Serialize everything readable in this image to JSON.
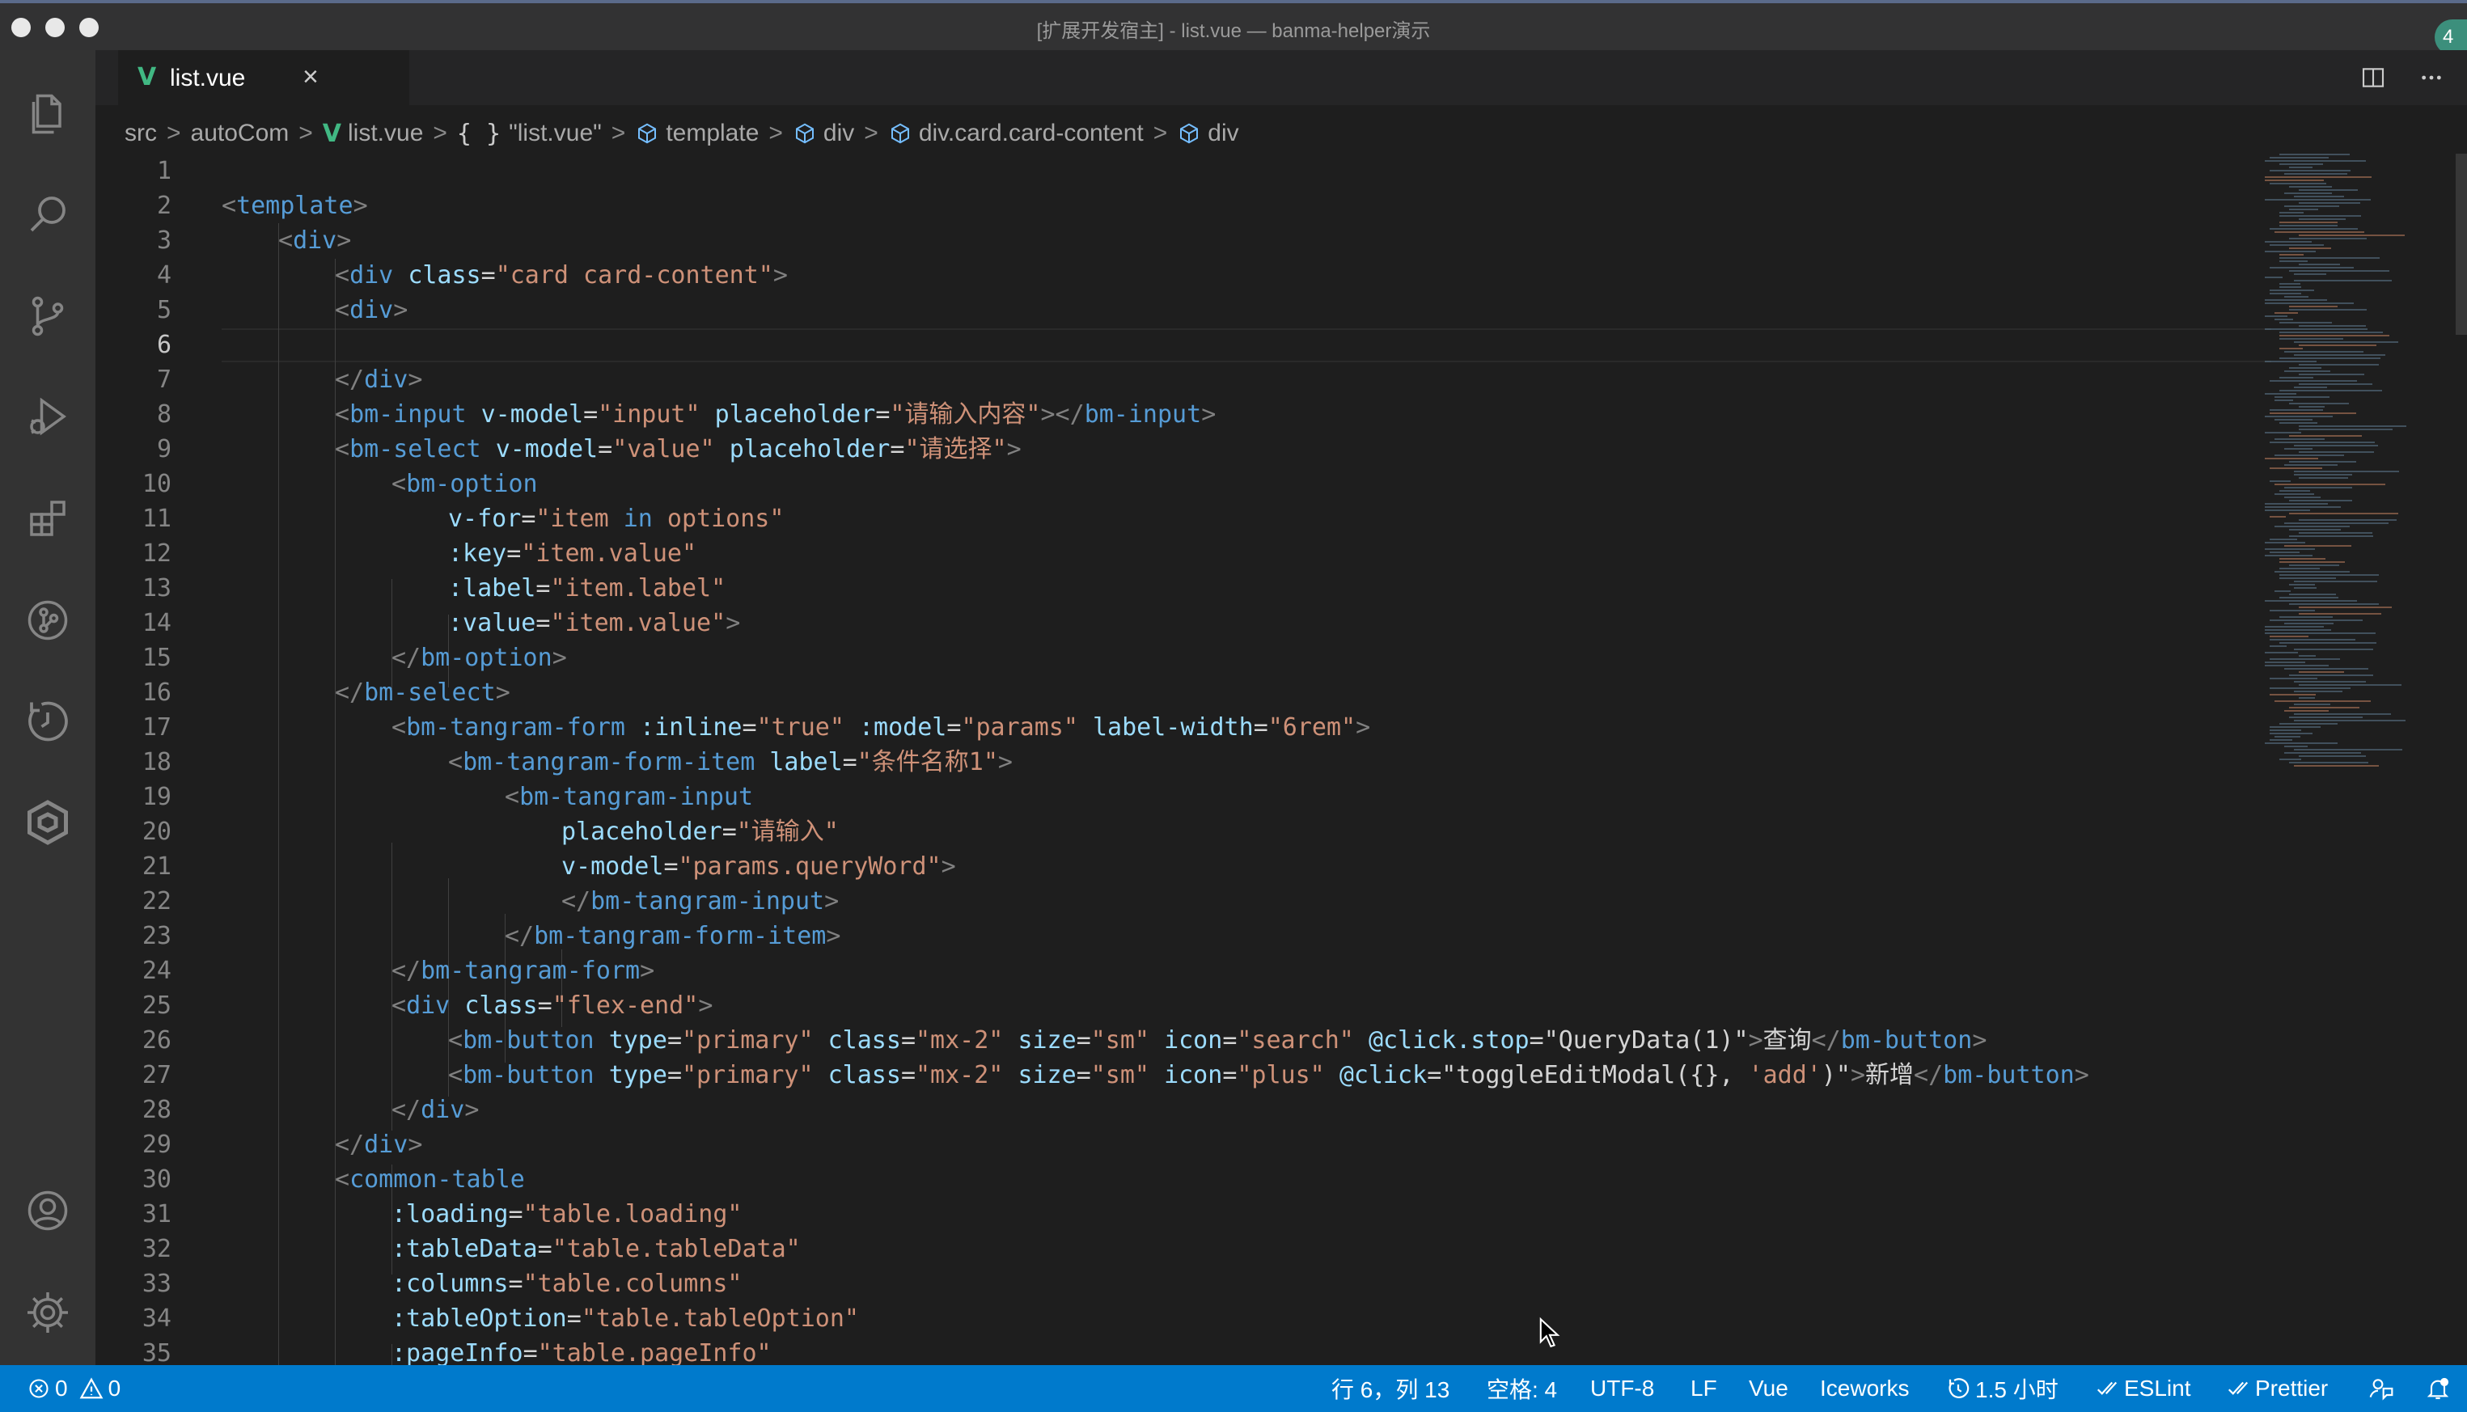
{
  "window": {
    "title": "[扩展开发宿主] - list.vue — banma-helper演示",
    "badge": "4"
  },
  "activity_bar": {
    "items": [
      {
        "name": "explorer-icon"
      },
      {
        "name": "search-icon"
      },
      {
        "name": "source-control-icon"
      },
      {
        "name": "run-debug-icon"
      },
      {
        "name": "extensions-icon"
      },
      {
        "name": "gitlens-icon"
      },
      {
        "name": "timeline-icon"
      },
      {
        "name": "iceworks-icon"
      }
    ],
    "bottom": [
      {
        "name": "account-icon"
      },
      {
        "name": "settings-gear-icon"
      }
    ]
  },
  "tab": {
    "label": "list.vue",
    "close": "×",
    "icon": "V"
  },
  "breadcrumb": {
    "src": "src",
    "autocom": "autoCom",
    "file": "list.vue",
    "braces": "{ }",
    "sfc": "\"list.vue\"",
    "template": "template",
    "div1": "div",
    "card": "div.card.card-content",
    "div2": "div",
    "separator": ">"
  },
  "editor": {
    "active_line": 6,
    "line_numbers": [
      "1",
      "2",
      "3",
      "4",
      "5",
      "6",
      "7",
      "8",
      "9",
      "10",
      "11",
      "12",
      "13",
      "14",
      "15",
      "16",
      "17",
      "18",
      "19",
      "20",
      "21",
      "22",
      "23",
      "24",
      "25",
      "26",
      "27",
      "28",
      "29",
      "30",
      "31",
      "32",
      "33",
      "34",
      "35"
    ]
  },
  "code": {
    "l2": {
      "a": "<",
      "b": "template",
      "c": ">"
    },
    "l3": {
      "a": "<",
      "b": "div",
      "c": ">"
    },
    "l4": {
      "a": "<",
      "b": "div",
      "c": " ",
      "d": "class",
      "e": "=",
      "f": "\"card card-content\"",
      "g": ">"
    },
    "l5": {
      "a": "<",
      "b": "div",
      "c": ">"
    },
    "l7": {
      "a": "</",
      "b": "div",
      "c": ">"
    },
    "l8": {
      "a": "<",
      "b": "bm-input",
      "c": " ",
      "d": "v-model",
      "e": "=",
      "f": "\"input\"",
      "g": " ",
      "h": "placeholder",
      "i": "=",
      "j": "\"请输入内容\"",
      "k": "></",
      "l": "bm-input",
      "m": ">"
    },
    "l9": {
      "a": "<",
      "b": "bm-select",
      "c": " ",
      "d": "v-model",
      "e": "=",
      "f": "\"value\"",
      "g": " ",
      "h": "placeholder",
      "i": "=",
      "j": "\"请选择\"",
      "k": ">"
    },
    "l10": {
      "a": "<",
      "b": "bm-option"
    },
    "l11": {
      "a": "v-for",
      "b": "=",
      "c": "\"item ",
      "d": "in",
      "e": " options\""
    },
    "l12": {
      "a": ":key",
      "b": "=",
      "c": "\"item.value\""
    },
    "l13": {
      "a": ":label",
      "b": "=",
      "c": "\"item.label\""
    },
    "l14": {
      "a": ":value",
      "b": "=",
      "c": "\"item.value\"",
      "d": ">"
    },
    "l15": {
      "a": "</",
      "b": "bm-option",
      "c": ">"
    },
    "l16": {
      "a": "</",
      "b": "bm-select",
      "c": ">"
    },
    "l17": {
      "a": "<",
      "b": "bm-tangram-form",
      "c": " ",
      "d": ":inline",
      "e": "=",
      "f": "\"true\"",
      "g": " ",
      "h": ":model",
      "i": "=",
      "j": "\"params\"",
      "k": " ",
      "l": "label-width",
      "m": "=",
      "n": "\"6rem\"",
      "o": ">"
    },
    "l18": {
      "a": "<",
      "b": "bm-tangram-form-item",
      "c": " ",
      "d": "label",
      "e": "=",
      "f": "\"条件名称1\"",
      "g": ">"
    },
    "l19": {
      "a": "<",
      "b": "bm-tangram-input"
    },
    "l20": {
      "a": "placeholder",
      "b": "=",
      "c": "\"请输入\""
    },
    "l21": {
      "a": "v-model",
      "b": "=",
      "c": "\"params.queryWord\"",
      "d": ">"
    },
    "l22": {
      "a": "</",
      "b": "bm-tangram-input",
      "c": ">"
    },
    "l23": {
      "a": "</",
      "b": "bm-tangram-form-item",
      "c": ">"
    },
    "l24": {
      "a": "</",
      "b": "bm-tangram-form",
      "c": ">"
    },
    "l25": {
      "a": "<",
      "b": "div",
      "c": " ",
      "d": "class",
      "e": "=",
      "f": "\"flex-end\"",
      "g": ">"
    },
    "l26": {
      "a": "<",
      "b": "bm-button",
      "c": " ",
      "d": "type",
      "e": "=",
      "f": "\"primary\"",
      "g": " ",
      "h": "class",
      "i": "=",
      "j": "\"mx-2\"",
      "k": " ",
      "l": "size",
      "m": "=",
      "n": "\"sm\"",
      "o": " ",
      "p": "icon",
      "q": "=",
      "r": "\"search\"",
      "s": " ",
      "t": "@click.stop",
      "u": "=",
      "v": "\"QueryData(1)\"",
      "w": ">",
      "x": "查询",
      "y": "</",
      "z": "bm-button",
      "z2": ">"
    },
    "l27": {
      "a": "<",
      "b": "bm-button",
      "c": " ",
      "d": "type",
      "e": "=",
      "f": "\"primary\"",
      "g": " ",
      "h": "class",
      "i": "=",
      "j": "\"mx-2\"",
      "k": " ",
      "l": "size",
      "m": "=",
      "n": "\"sm\"",
      "o": " ",
      "p": "icon",
      "q": "=",
      "r": "\"plus\"",
      "s": " ",
      "t": "@click",
      "u": "=",
      "v": "\"toggleEditModal({}, ",
      "v2": "'add'",
      "v3": ")\"",
      "w": ">",
      "x": "新增",
      "y": "</",
      "z": "bm-button",
      "z2": ">"
    },
    "l28": {
      "a": "</",
      "b": "div",
      "c": ">"
    },
    "l29": {
      "a": "</",
      "b": "div",
      "c": ">"
    },
    "l30": {
      "a": "<",
      "b": "common-table"
    },
    "l31": {
      "a": ":loading",
      "b": "=",
      "c": "\"table.loading\""
    },
    "l32": {
      "a": ":tableData",
      "b": "=",
      "c": "\"table.tableData\""
    },
    "l33": {
      "a": ":columns",
      "b": "=",
      "c": "\"table.columns\""
    },
    "l34": {
      "a": ":tableOption",
      "b": "=",
      "c": "\"table.tableOption\""
    },
    "l35": {
      "a": ":pageInfo",
      "b": "=",
      "c": "\"table.pageInfo\""
    }
  },
  "status_bar": {
    "errors": "0",
    "warnings": "0",
    "cursor_position": "行 6，列 13",
    "indent": "空格: 4",
    "encoding": "UTF-8",
    "eol": "LF",
    "language": "Vue",
    "iceworks": "Iceworks",
    "time": "1.5 小时",
    "eslint": "ESLint",
    "prettier": "Prettier"
  },
  "colors": {
    "tag": "#569cd6",
    "attribute": "#9cdcfe",
    "string": "#ce9178",
    "punctuation": "#808080",
    "status_bar": "#007acc",
    "activity_bar": "#333333",
    "editor_bg": "#1e1e1e",
    "vue": "#41b883"
  }
}
